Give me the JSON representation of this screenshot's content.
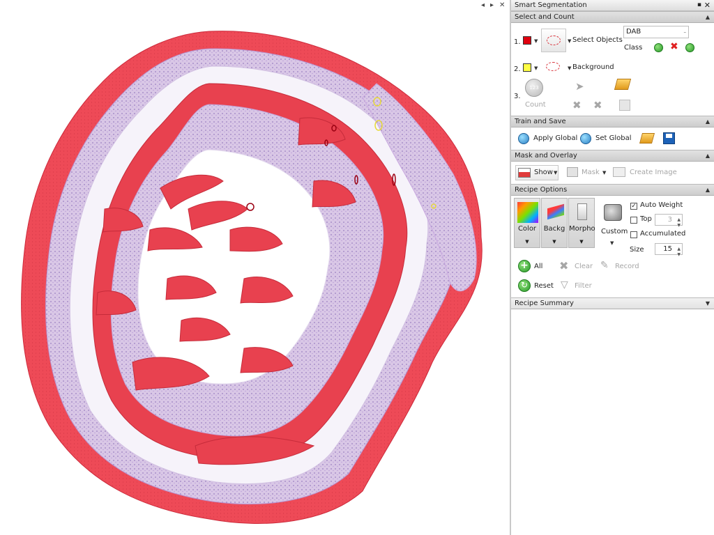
{
  "viewer": {
    "controls": [
      "◂",
      "▸",
      "✕"
    ]
  },
  "panel": {
    "title": "Smart Segmentation",
    "pin_glyph": "▪",
    "close_glyph": "✕",
    "sections": {
      "select_and_count": {
        "header": "Select and Count",
        "step1": {
          "number": "1.",
          "swatch_color": "#e0000f",
          "label": "Select Objects"
        },
        "class_combo": {
          "value": "DAB"
        },
        "class_label": "Class",
        "step2": {
          "number": "2.",
          "swatch_color": "#ffff44",
          "label": "Background"
        },
        "step3": {
          "number": "3.",
          "count_label": "Count"
        }
      },
      "train_and_save": {
        "header": "Train and Save",
        "apply_global": "Apply Global",
        "set_global": "Set Global"
      },
      "mask_and_overlay": {
        "header": "Mask and Overlay",
        "show": "Show",
        "mask": "Mask",
        "create_image": "Create Image"
      },
      "recipe_options": {
        "header": "Recipe Options",
        "tiles": [
          {
            "label": "Color"
          },
          {
            "label": "Backg"
          },
          {
            "label": "Morpho"
          }
        ],
        "custom": "Custom",
        "auto_weight": {
          "label": "Auto Weight",
          "checked": true
        },
        "top": {
          "label": "Top",
          "checked": false,
          "value": "3"
        },
        "accumulated": {
          "label": "Accumulated",
          "checked": false
        },
        "size": {
          "label": "Size",
          "value": "15"
        },
        "all": "All",
        "clear": "Clear",
        "record": "Record",
        "reset": "Reset",
        "filter": "Filter"
      },
      "recipe_summary": {
        "header": "Recipe Summary"
      }
    }
  }
}
